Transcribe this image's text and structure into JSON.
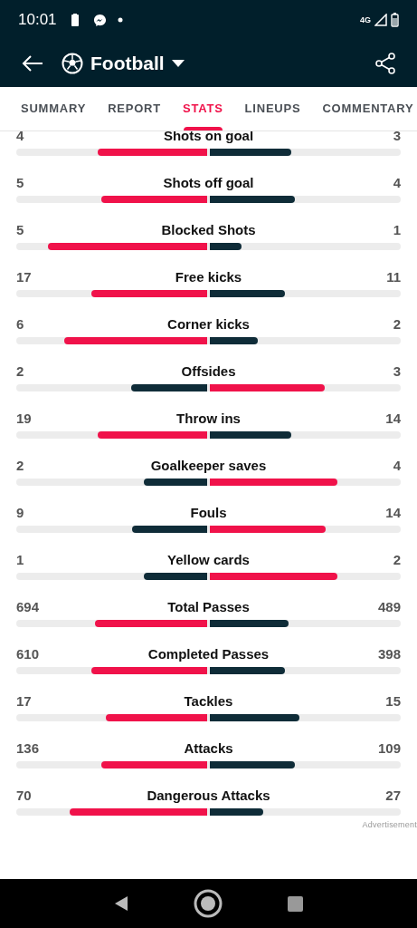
{
  "status_bar": {
    "time": "10:01",
    "network": "4G"
  },
  "header": {
    "title": "Football"
  },
  "tabs": [
    {
      "label": "SUMMARY",
      "selected": false
    },
    {
      "label": "REPORT",
      "selected": false
    },
    {
      "label": "STATS",
      "selected": true
    },
    {
      "label": "LINEUPS",
      "selected": false
    },
    {
      "label": "COMMENTARY",
      "selected": false
    }
  ],
  "stats": [
    {
      "label": "Shots on goal",
      "home": {
        "value": "4",
        "leading": true
      },
      "away": {
        "value": "3",
        "leading": false
      }
    },
    {
      "label": "Shots off goal",
      "home": {
        "value": "5",
        "leading": true
      },
      "away": {
        "value": "4",
        "leading": false
      }
    },
    {
      "label": "Blocked Shots",
      "home": {
        "value": "5",
        "leading": true
      },
      "away": {
        "value": "1",
        "leading": false
      }
    },
    {
      "label": "Free kicks",
      "home": {
        "value": "17",
        "leading": true
      },
      "away": {
        "value": "11",
        "leading": false
      }
    },
    {
      "label": "Corner kicks",
      "home": {
        "value": "6",
        "leading": true
      },
      "away": {
        "value": "2",
        "leading": false
      }
    },
    {
      "label": "Offsides",
      "home": {
        "value": "2",
        "leading": false
      },
      "away": {
        "value": "3",
        "leading": true
      }
    },
    {
      "label": "Throw ins",
      "home": {
        "value": "19",
        "leading": true
      },
      "away": {
        "value": "14",
        "leading": false
      }
    },
    {
      "label": "Goalkeeper saves",
      "home": {
        "value": "2",
        "leading": false
      },
      "away": {
        "value": "4",
        "leading": true
      }
    },
    {
      "label": "Fouls",
      "home": {
        "value": "9",
        "leading": false
      },
      "away": {
        "value": "14",
        "leading": true
      }
    },
    {
      "label": "Yellow cards",
      "home": {
        "value": "1",
        "leading": false
      },
      "away": {
        "value": "2",
        "leading": true
      }
    },
    {
      "label": "Total Passes",
      "home": {
        "value": "694",
        "leading": true
      },
      "away": {
        "value": "489",
        "leading": false
      }
    },
    {
      "label": "Completed Passes",
      "home": {
        "value": "610",
        "leading": true
      },
      "away": {
        "value": "398",
        "leading": false
      }
    },
    {
      "label": "Tackles",
      "home": {
        "value": "17",
        "leading": true
      },
      "away": {
        "value": "15",
        "leading": false
      }
    },
    {
      "label": "Attacks",
      "home": {
        "value": "136",
        "leading": true
      },
      "away": {
        "value": "109",
        "leading": false
      }
    },
    {
      "label": "Dangerous Attacks",
      "home": {
        "value": "70",
        "leading": true
      },
      "away": {
        "value": "27",
        "leading": false
      }
    }
  ],
  "advertisement": "Advertisement"
}
